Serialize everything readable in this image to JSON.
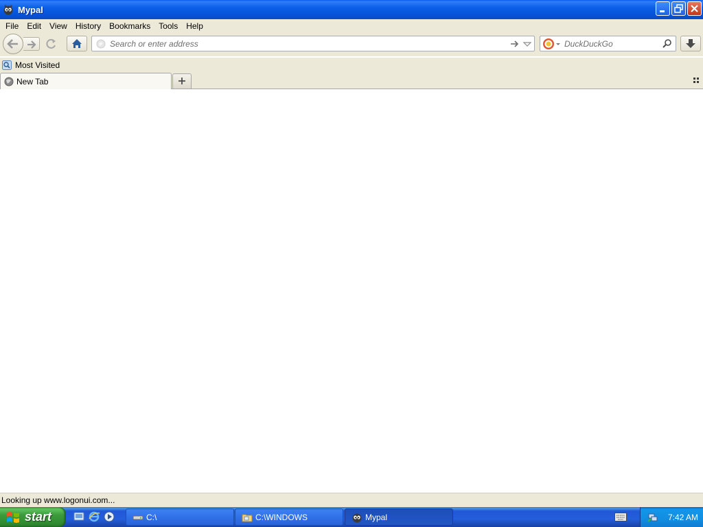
{
  "window": {
    "title": "Mypal",
    "controls": {
      "minimize": "minimize",
      "restore": "restore",
      "close": "close"
    }
  },
  "menu": {
    "items": [
      "File",
      "Edit",
      "View",
      "History",
      "Bookmarks",
      "Tools",
      "Help"
    ]
  },
  "navigation": {
    "address_placeholder": "Search or enter address",
    "address_value": "",
    "search_engine": "DuckDuckGo",
    "search_placeholder": "DuckDuckGo"
  },
  "bookmarks": {
    "items": [
      {
        "label": "Most Visited",
        "icon": "most-visited-icon"
      }
    ]
  },
  "tabs": {
    "items": [
      {
        "label": "New Tab",
        "icon": "globe-icon",
        "active": true
      }
    ]
  },
  "status": {
    "text": "Looking up www.logonui.com..."
  },
  "taskbar": {
    "start_label": "start",
    "quicklaunch": [
      "show-desktop-icon",
      "internet-explorer-icon",
      "media-player-icon"
    ],
    "tasks": [
      {
        "label": "C:\\",
        "icon": "drive-icon",
        "active": false
      },
      {
        "label": "C:\\WINDOWS",
        "icon": "folder-icon",
        "active": false
      },
      {
        "label": "Mypal",
        "icon": "mypal-icon",
        "active": true
      }
    ],
    "clock": "7:42 AM"
  },
  "colors": {
    "titlebar": "#0553d8",
    "chrome": "#ece9d8",
    "taskbar": "#245edb",
    "start_button": "#3c9a3c",
    "tray": "#118ee2"
  }
}
